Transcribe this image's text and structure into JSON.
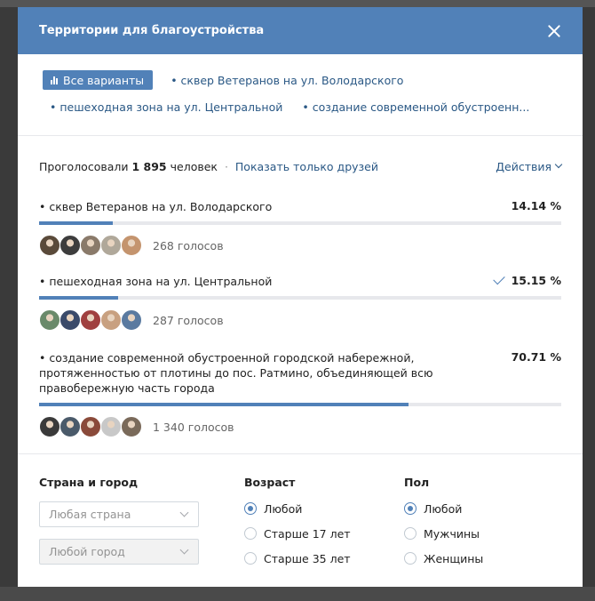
{
  "modal": {
    "title": "Территории для благоустройства"
  },
  "options": {
    "all_label": "Все варианты",
    "links": [
      "• сквер Ветеранов на ул. Володарского",
      "• пешеходная зона на ул. Центральной",
      "• создание современной обустроенн..."
    ]
  },
  "summary": {
    "voted_prefix": "Проголосовали",
    "voted_count": "1 895",
    "voted_suffix": "человек",
    "separator": "·",
    "friends_link": "Показать только друзей",
    "actions_label": "Действия"
  },
  "answers": [
    {
      "text": "• сквер Ветеранов на ул. Володарского",
      "percent_label": "14.14 %",
      "percent": 14.14,
      "votes_label": "268 голосов",
      "checked": false,
      "avatar_colors": [
        "#5a4a3a",
        "#3d3d3d",
        "#8a7a6a",
        "#b0a89a",
        "#c4946e"
      ]
    },
    {
      "text": "• пешеходная зона на ул. Центральной",
      "percent_label": "15.15 %",
      "percent": 15.15,
      "votes_label": "287 голосов",
      "checked": true,
      "avatar_colors": [
        "#6a8a6a",
        "#3a4a6a",
        "#a04040",
        "#c8a080",
        "#5a7aa0"
      ]
    },
    {
      "text": "• создание современной обустроенной городской набережной, протяженностью от плотины до пос. Ратмино, объединяющей всю правобережную часть города",
      "percent_label": "70.71 %",
      "percent": 70.71,
      "votes_label": "1 340 голосов",
      "checked": false,
      "avatar_colors": [
        "#3a3a3a",
        "#4a5a6a",
        "#8a4a3a",
        "#c8c8c8",
        "#7a6a5a"
      ]
    }
  ],
  "filters": {
    "location": {
      "title": "Страна и город",
      "country_placeholder": "Любая страна",
      "city_placeholder": "Любой город"
    },
    "age": {
      "title": "Возраст",
      "options": [
        "Любой",
        "Старше 17 лет",
        "Старше 35 лет"
      ],
      "selected": 0
    },
    "sex": {
      "title": "Пол",
      "options": [
        "Любой",
        "Мужчины",
        "Женщины"
      ],
      "selected": 0
    }
  },
  "colors": {
    "accent": "#5181b8",
    "link": "#2a5885",
    "bar_track": "#e7e8ec"
  }
}
